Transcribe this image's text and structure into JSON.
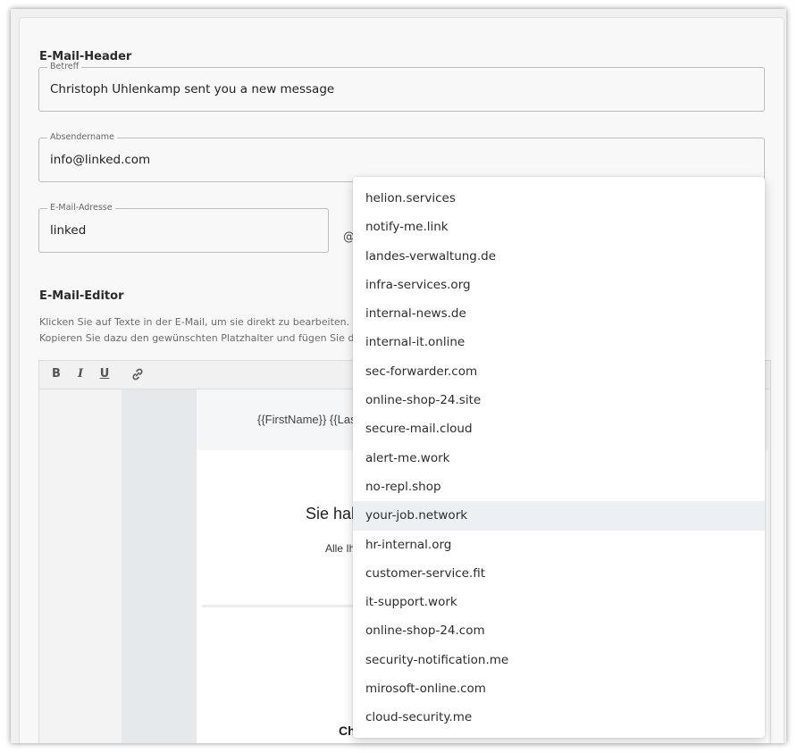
{
  "email_header": {
    "section_title": "E-Mail-Header",
    "subject": {
      "label": "Betreff",
      "value": "Christoph Uhlenkamp sent you a new message"
    },
    "sender_name": {
      "label": "Absendername",
      "value": "info@linked.com"
    },
    "email_address": {
      "label": "E-Mail-Adresse",
      "value": "linked",
      "at": "@"
    }
  },
  "email_editor": {
    "section_title": "E-Mail-Editor",
    "hint_line1": "Klicken Sie auf Texte in der E-Mail, um sie direkt zu bearbeiten. Sie",
    "hint_line2": "Kopieren Sie dazu den gewünschten Platzhalter und fügen Sie dies",
    "toolbar": {
      "bold": "B",
      "italic": "I",
      "underline": "U",
      "link_icon": "link-icon"
    },
    "preview": {
      "header_text": "{{FirstName}} {{Las",
      "headline": "Sie hab",
      "subline": "Alle Ih",
      "bold_text": "Ch"
    }
  },
  "domain_dropdown": {
    "options": [
      "helion.services",
      "notify-me.link",
      "landes-verwaltung.de",
      "infra-services.org",
      "internal-news.de",
      "internal-it.online",
      "sec-forwarder.com",
      "online-shop-24.site",
      "secure-mail.cloud",
      "alert-me.work",
      "no-repl.shop",
      "your-job.network",
      "hr-internal.org",
      "customer-service.fit",
      "it-support.work",
      "online-shop-24.com",
      "security-notification.me",
      "mirosoft-online.com",
      "cloud-security.me"
    ],
    "highlighted_option": "your-job.network"
  }
}
